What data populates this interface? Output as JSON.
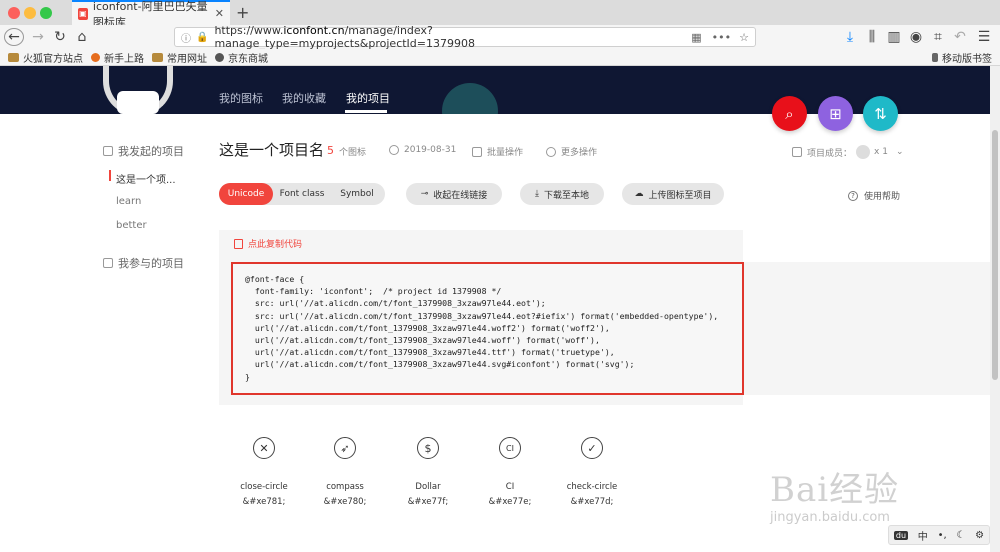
{
  "browser": {
    "tab_title": "iconfont-阿里巴巴矢量图标库",
    "url_prefix": "https://www.",
    "url_domain": "iconfont.cn",
    "url_rest": "/manage/index?manage_type=myprojects&projectId=1379908",
    "bookmarks": [
      "火狐官方站点",
      "新手上路",
      "常用网址",
      "京东商城"
    ],
    "mobile_bookmarks": "移动版书签"
  },
  "header": {
    "nav": [
      "我的图标",
      "我的收藏",
      "我的项目"
    ],
    "active": "我的项目"
  },
  "sidebar": {
    "my_projects_title": "我发起的项目",
    "items": [
      "这是一个项...",
      "learn",
      "better"
    ],
    "joined_title": "我参与的项目"
  },
  "project": {
    "name": "这是一个项目名",
    "icon_count": "5",
    "icon_count_label": "个图标",
    "date": "2019-08-31",
    "batch_action": "批量操作",
    "more_action": "更多操作",
    "members_label": "项目成员：",
    "members_count": "x 1"
  },
  "toolbar": {
    "tabs": [
      "Unicode",
      "Font class",
      "Symbol"
    ],
    "active_tab": "Unicode",
    "collapse_link": "收起在线链接",
    "download": "下载至本地",
    "upload": "上传图标至项目",
    "help": "使用帮助"
  },
  "code": {
    "copy_label": "点此复制代码",
    "text": "@font-face {\n  font-family: 'iconfont';  /* project id 1379908 */\n  src: url('//at.alicdn.com/t/font_1379908_3xzaw97le44.eot');\n  src: url('//at.alicdn.com/t/font_1379908_3xzaw97le44.eot?#iefix') format('embedded-opentype'),\n  url('//at.alicdn.com/t/font_1379908_3xzaw97le44.woff2') format('woff2'),\n  url('//at.alicdn.com/t/font_1379908_3xzaw97le44.woff') format('woff'),\n  url('//at.alicdn.com/t/font_1379908_3xzaw97le44.ttf') format('truetype'),\n  url('//at.alicdn.com/t/font_1379908_3xzaw97le44.svg#iconfont') format('svg');\n}"
  },
  "icons": [
    {
      "name": "close-circle",
      "code": "&#xe781;",
      "glyph": "✕"
    },
    {
      "name": "compass",
      "code": "&#xe780;",
      "glyph": "➶"
    },
    {
      "name": "Dollar",
      "code": "&#xe77f;",
      "glyph": "$"
    },
    {
      "name": "CI",
      "code": "&#xe77e;",
      "glyph": "CI"
    },
    {
      "name": "check-circle",
      "code": "&#xe77d;",
      "glyph": "✓"
    }
  ],
  "watermark": {
    "main": "Bai经验",
    "sub": "jingyan.baidu.com"
  },
  "ime": {
    "lang": "中",
    "punct": "•,"
  },
  "colors": {
    "accent": "#f1453d",
    "header_bg": "#0f1733",
    "fab_purple": "#8e62e0",
    "fab_teal": "#1fb9c8"
  }
}
